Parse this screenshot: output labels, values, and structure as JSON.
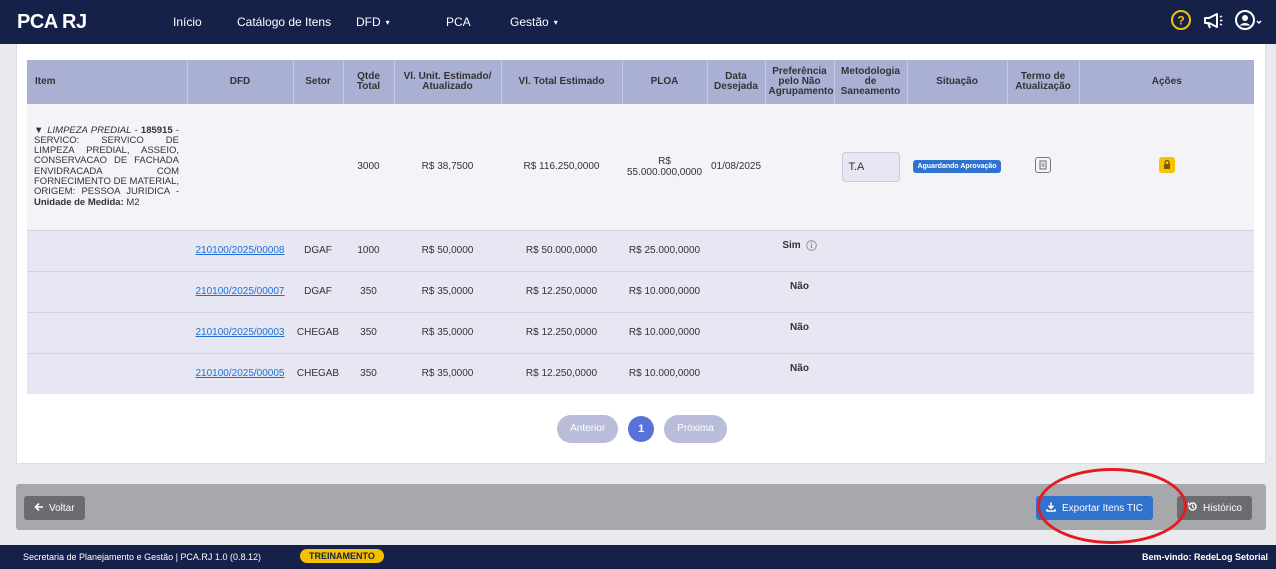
{
  "nav": {
    "brand": "PCA RJ",
    "items": [
      {
        "label": "Início",
        "caret": ""
      },
      {
        "label": "Catálogo de Itens",
        "caret": ""
      },
      {
        "label": "DFD",
        "caret": "▾"
      },
      {
        "label": "PCA",
        "caret": ""
      },
      {
        "label": "Gestão",
        "caret": "▾"
      }
    ],
    "icons": [
      "help-icon",
      "megaphone-icon",
      "user-icon"
    ],
    "accent": "#f5c000"
  },
  "table": {
    "headers": {
      "item": "Item",
      "dfd": "DFD",
      "setor": "Setor",
      "qtde": "Qtde Total",
      "vl_unit": "Vl. Unit. Estimado/ Atualizado",
      "vl_total": "Vl. Total Estimado",
      "ploa": "PLOA",
      "data": "Data Desejada",
      "preferencia": "Preferência pelo Não Agrupamento",
      "metodologia": "Metodologia de Saneamento",
      "situacao": "Situação",
      "termo": "Termo de Atualização",
      "acoes": "Ações"
    },
    "main": {
      "category": "▼ LIMPEZA PREDIAL -",
      "code": "185915",
      "description": " - SERVICO: SERVICO DE LIMPEZA PREDIAL, ASSEIO, CONSERVACAO DE FACHADA ENVIDRACADA COM FORNECIMENTO DE MATERIAL, ORIGEM: PESSOA JURIDICA - ",
      "unit_label": "Unidade de Medida:",
      "unit": " M2",
      "qtde": "3000",
      "vl_unit": "R$ 38,7500",
      "vl_total": "R$ 116.250,0000",
      "ploa": "R$ 55.000.000,0000",
      "data": "01/08/2025",
      "metodologia": "T.A",
      "situacao": "Aguardando Aprovação"
    },
    "rows": [
      {
        "dfd": "210100/2025/00008",
        "setor": "DGAF",
        "qtde": "1000",
        "vl_unit": "R$ 50,0000",
        "vl_total": "R$ 50.000,0000",
        "ploa": "R$ 25.000,0000",
        "preferencia": "Sim"
      },
      {
        "dfd": "210100/2025/00007",
        "setor": "DGAF",
        "qtde": "350",
        "vl_unit": "R$ 35,0000",
        "vl_total": "R$ 12.250,0000",
        "ploa": "R$ 10.000,0000",
        "preferencia": "Não"
      },
      {
        "dfd": "210100/2025/00003",
        "setor": "CHEGAB",
        "qtde": "350",
        "vl_unit": "R$ 35,0000",
        "vl_total": "R$ 12.250,0000",
        "ploa": "R$ 10.000,0000",
        "preferencia": "Não"
      },
      {
        "dfd": "210100/2025/00005",
        "setor": "CHEGAB",
        "qtde": "350",
        "vl_unit": "R$ 35,0000",
        "vl_total": "R$ 12.250,0000",
        "ploa": "R$ 10.000,0000",
        "preferencia": "Não"
      }
    ]
  },
  "pagination": {
    "prev": "Anterior",
    "page": "1",
    "next": "Próxima"
  },
  "bottom": {
    "back": "Voltar",
    "export": "Exportar Itens TIC",
    "history": "Histórico"
  },
  "footer": {
    "left": "Secretaria de Planejamento e Gestão | PCA.RJ 1.0 (0.8.12)",
    "badge": "TREINAMENTO",
    "right": "Bem-vindo: RedeLog Setorial"
  }
}
